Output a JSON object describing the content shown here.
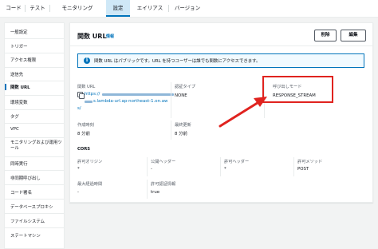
{
  "tabs": [
    {
      "label": "コード",
      "active": false
    },
    {
      "label": "テスト",
      "active": false
    },
    {
      "label": "モニタリング",
      "active": false
    },
    {
      "label": "設定",
      "active": true
    },
    {
      "label": "エイリアス",
      "active": false
    },
    {
      "label": "バージョン",
      "active": false
    }
  ],
  "sidebar": {
    "items": [
      {
        "label": "一般設定"
      },
      {
        "label": "トリガー"
      },
      {
        "label": "アクセス権限"
      },
      {
        "label": "送信先"
      },
      {
        "label": "関数 URL",
        "active": true
      },
      {
        "label": "環境変数"
      },
      {
        "label": "タグ"
      },
      {
        "label": "VPC"
      },
      {
        "label": "モニタリングおよび運用ツール"
      },
      {
        "label": "同時実行"
      },
      {
        "label": "非同期呼び出し"
      },
      {
        "label": "コード署名"
      },
      {
        "label": "データベースプロキシ"
      },
      {
        "label": "ファイルシステム"
      },
      {
        "label": "ステートマシン"
      }
    ]
  },
  "panel": {
    "title": "関数 URL",
    "info_link": "情報",
    "delete_button": "削除",
    "edit_button": "編集",
    "alert_text": "関数 URL はパブリックです。URL を持つユーザーは誰でも関数にアクセスできます。",
    "url_label": "関数 URL",
    "url_prefix": "https://",
    "url_line2": "s.lambda-url.ap-northeast-1.on.aw",
    "url_line3": "s/",
    "auth_type_label": "認証タイプ",
    "auth_type_value": "NONE",
    "invoke_mode_label": "呼び出しモード",
    "invoke_mode_value": "RESPONSE_STREAM",
    "created_label": "作成時刻",
    "created_value": "8 分前",
    "updated_label": "最終更新",
    "updated_value": "8 分前",
    "cors_heading": "CORS",
    "allow_origin_label": "許可オリジン",
    "allow_origin_value": "*",
    "expose_headers_label": "公開ヘッダー",
    "expose_headers_value": "-",
    "allow_headers_label": "許可ヘッダー",
    "allow_headers_value": "*",
    "allow_methods_label": "許可メソッド",
    "allow_methods_value": "POST",
    "max_age_label": "最大経過時間",
    "max_age_value": "-",
    "allow_credentials_label": "許可認証情報",
    "allow_credentials_value": "true"
  },
  "colors": {
    "accent": "#0073bb",
    "annotation_red": "#e0231f"
  },
  "icons": [
    "info-icon",
    "copy-icon",
    "arrow-annotation"
  ]
}
